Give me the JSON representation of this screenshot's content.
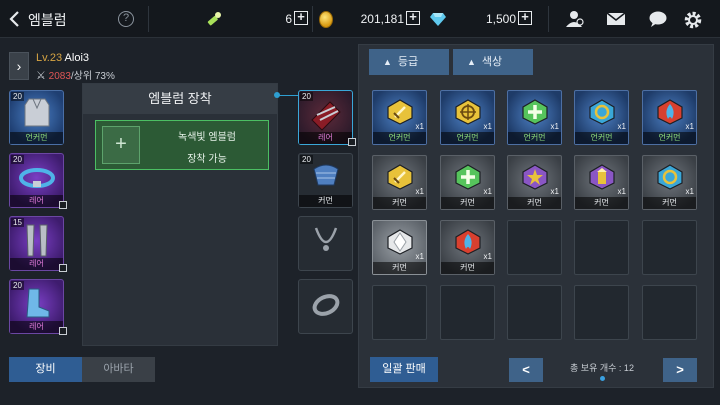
{
  "header": {
    "title": "엠블럼",
    "help": "?",
    "energy": "6",
    "gold": "201,181",
    "gems": "1,500"
  },
  "profile": {
    "level": "Lv.23",
    "name": "Aloi3",
    "power": "2083",
    "rank": "/상위 73%"
  },
  "equipment_left": [
    {
      "level": "20",
      "grade": "언커먼",
      "grade_class": "uncommon",
      "icon": "armor-vest-icon"
    },
    {
      "level": "20",
      "grade": "레어",
      "grade_class": "rare",
      "icon": "belt-icon"
    },
    {
      "level": "15",
      "grade": "레어",
      "grade_class": "rare",
      "icon": "leg-guard-icon"
    },
    {
      "level": "20",
      "grade": "레어",
      "grade_class": "rare",
      "icon": "boots-icon"
    }
  ],
  "equipment_right": [
    {
      "level": "20",
      "grade": "레어",
      "grade_class": "rare",
      "icon": "gauntlet-icon"
    },
    {
      "level": "20",
      "grade": "커먼",
      "grade_class": "common",
      "icon": "glove-icon"
    },
    {
      "level": "",
      "grade": "",
      "icon": "necklace-icon"
    },
    {
      "level": "",
      "grade": "",
      "icon": "ring-icon"
    }
  ],
  "emblem": {
    "header": "엠블럼 장착",
    "slot_line1": "녹색빛 엠블럼",
    "slot_line2": "장착 가능",
    "plus": "+"
  },
  "tabs": {
    "equip": "장비",
    "avatar": "아바타"
  },
  "filters": {
    "grade": "등급",
    "color": "색상",
    "arrow": "▲"
  },
  "inventory": [
    {
      "grade": "언커먼",
      "grade_class": "uncommon",
      "qty": "x1",
      "icon": "sword-emblem-icon",
      "bg": "blue",
      "color": "#e8c23a"
    },
    {
      "grade": "언커먼",
      "grade_class": "uncommon",
      "qty": "x1",
      "icon": "crosshair-emblem-icon",
      "bg": "blue",
      "color": "#e8c23a"
    },
    {
      "grade": "언커먼",
      "grade_class": "uncommon",
      "qty": "x1",
      "icon": "cross-emblem-icon",
      "bg": "blue",
      "color": "#56c45c"
    },
    {
      "grade": "언커먼",
      "grade_class": "uncommon",
      "qty": "x1",
      "icon": "ring-emblem-icon",
      "bg": "blue",
      "color": "#3aa7d8"
    },
    {
      "grade": "언커먼",
      "grade_class": "uncommon",
      "qty": "x1",
      "icon": "flame-emblem-icon",
      "bg": "blue",
      "color": "#d8402f"
    },
    {
      "grade": "커먼",
      "grade_class": "common",
      "qty": "x1",
      "icon": "sword-emblem-icon",
      "bg": "gray",
      "color": "#e8c23a"
    },
    {
      "grade": "커먼",
      "grade_class": "common",
      "qty": "x1",
      "icon": "cross-emblem-icon",
      "bg": "gray",
      "color": "#56c45c"
    },
    {
      "grade": "커먼",
      "grade_class": "common",
      "qty": "x1",
      "icon": "star-emblem-icon",
      "bg": "gray",
      "color": "#8a56c4"
    },
    {
      "grade": "커먼",
      "grade_class": "common",
      "qty": "x1",
      "icon": "tower-emblem-icon",
      "bg": "gray",
      "color": "#8a56c4"
    },
    {
      "grade": "커먼",
      "grade_class": "common",
      "qty": "x1",
      "icon": "ring-emblem-icon",
      "bg": "gray",
      "color": "#3aa7d8"
    },
    {
      "grade": "커먼",
      "grade_class": "common",
      "qty": "x1",
      "icon": "shard-emblem-icon",
      "bg": "white",
      "color": "#e6e8ea"
    },
    {
      "grade": "커먼",
      "grade_class": "common",
      "qty": "x1",
      "icon": "flame-emblem-icon",
      "bg": "gray",
      "color": "#d8402f"
    },
    {},
    {},
    {},
    {},
    {},
    {},
    {},
    {}
  ],
  "footer": {
    "sell_all": "일괄 판매",
    "prev": "<",
    "next": ">",
    "total": "총 보유 개수 : 12"
  },
  "colors": {
    "accent": "#2f5d93",
    "highlight": "#2e9fd1",
    "emblem_green": "#4cbf63"
  }
}
